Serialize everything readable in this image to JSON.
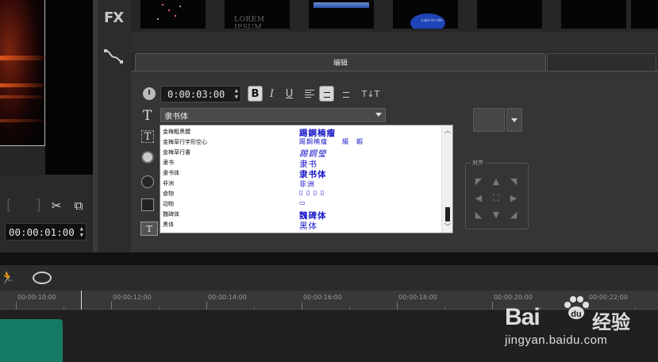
{
  "preview": {
    "timecode": "00:00:01:00",
    "brackets_label": "[ ]"
  },
  "effects": {
    "fx_label": "FX"
  },
  "thumbnails": {
    "items": [
      {
        "id": "sparkles"
      },
      {
        "id": "lorem",
        "text": "LOREM IPSUM"
      },
      {
        "id": "blue-bar"
      },
      {
        "id": "blue-ellipse",
        "text": "Label for title"
      },
      {
        "id": "blank-5"
      },
      {
        "id": "blank-6"
      },
      {
        "id": "blank-7"
      }
    ]
  },
  "options": {
    "tab_label": "编辑",
    "duration": "0:00:03:00",
    "font_selected": "隶书体",
    "align_label": "对齐",
    "colors": {
      "panel": "#353535",
      "sample": "#1515c8",
      "clip": "#147a63"
    }
  },
  "fonts": [
    {
      "name": "金梅粗黑體",
      "sample": "踢鋼楠瘤"
    },
    {
      "name": "金梅草行字形空心",
      "sample": "踢鋼楠瘤　　綴　蝦"
    },
    {
      "name": "金梅草行書",
      "sample": "踢鋼瑩"
    },
    {
      "name": "隶书",
      "sample": "隶书"
    },
    {
      "name": "隶书体",
      "sample": "隶书体"
    },
    {
      "name": "非洲",
      "sample": "非洲"
    },
    {
      "name": "食物",
      "sample": "▯ ▯ ▯ ▯"
    },
    {
      "name": "动物",
      "sample": "▭"
    },
    {
      "name": "魏碑体",
      "sample": "魏碑体"
    },
    {
      "name": "黑体",
      "sample": "黑体"
    }
  ],
  "timeline": {
    "ticks": [
      "00:00:10:00",
      "00:00:12:00",
      "00:00:14:00",
      "00:00:16:00",
      "00:00:18:00",
      "00:00:20:00",
      "00:00:22:00"
    ]
  },
  "watermark": {
    "bai": "Bai",
    "du": "du",
    "cn": "经验",
    "url": "jingyan.baidu.com"
  }
}
